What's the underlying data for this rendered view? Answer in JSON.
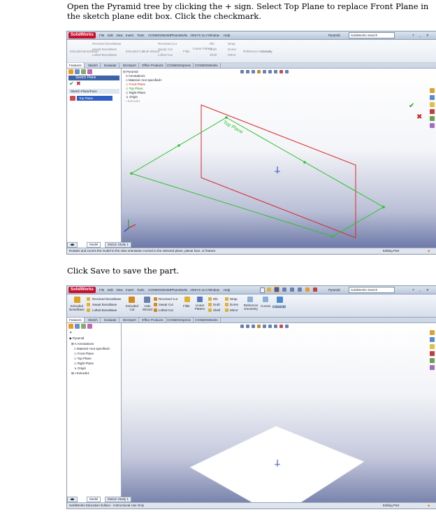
{
  "step1": {
    "instruction": "Open the Pyramid tree by clicking the + sign. Select Top Plane to replace Front Plane in the sketch plane edit box. Click the checkmark.",
    "app": {
      "logo": "SolidWorks",
      "menus": [
        "File",
        "Edit",
        "View",
        "Insert",
        "Tools",
        "COSMOSWorks",
        "PhotoWorks",
        "ANSYS 11.0",
        "Window",
        "Help"
      ],
      "doc_title": "Pyramid",
      "search_placeholder": "SolidWorks Search"
    },
    "ribbon": [
      "Extruded Boss/Base",
      "Revolved Boss/Base",
      "Swept Boss/Base",
      "Lofted Boss/Base",
      "Extruded Cut",
      "Hole Wizard",
      "Revolved Cut",
      "Swept Cut",
      "Lofted Cut",
      "Fillet",
      "Linear Pattern",
      "Rib",
      "Draft",
      "Shell",
      "Wrap",
      "Dome",
      "Mirror",
      "Reference Geometry",
      "Curves"
    ],
    "tabs": [
      "Features",
      "Sketch",
      "Evaluate",
      "DimXpert",
      "Office Products",
      "COSMOSXpress",
      "COSMOSWorks"
    ],
    "panel": {
      "title": "Sketch Plane",
      "section": "Sketch Plane/Face",
      "selection": "Top Plane"
    },
    "tree": [
      "Pyramid",
      "Annotations",
      "Material <not specified>",
      "Front Plane",
      "Top Plane",
      "Right Plane",
      "Origin",
      "Extrude1"
    ],
    "plane_label": "Top Plane",
    "bottom_tabs": [
      "Model",
      "Motion Study 1"
    ],
    "status": "Rotates and zooms the model to the view orientation normal to the selected plane, planar face, or feature.",
    "status_right": "Editing Part"
  },
  "step2": {
    "instruction": "Click Save to save the part.",
    "app": {
      "logo": "SolidWorks",
      "menus": [
        "File",
        "Edit",
        "View",
        "Insert",
        "Tools",
        "COSMOSWorks",
        "PhotoWorks",
        "ANSYS 11.0",
        "Window",
        "Help"
      ],
      "doc_title": "Pyramid",
      "search_placeholder": "SolidWorks Search"
    },
    "ribbon": [
      "Revolved Boss/Base",
      "Swept Boss/Base",
      "Lofted Boss/Base",
      "Extruded Boss/Base",
      "Extruded Cut",
      "Hole Wizard",
      "Revolved Cut",
      "Swept Cut",
      "Lofted Cut",
      "Fillet",
      "Linear Pattern",
      "Rib",
      "Draft",
      "Shell",
      "Wrap",
      "Dome",
      "Mirror",
      "Reference Geometry",
      "Curves",
      "Instant3D"
    ],
    "tabs": [
      "Features",
      "Sketch",
      "Evaluate",
      "DimXpert",
      "Office Products",
      "COSMOSXpress",
      "COSMOSWorks"
    ],
    "tree": [
      "Pyramid",
      "Annotations",
      "Material <not specified>",
      "Front Plane",
      "Top Plane",
      "Right Plane",
      "Origin",
      "Extrude1"
    ],
    "bottom_tabs": [
      "Model",
      "Motion Study 1"
    ],
    "status": "SolidWorks Education Edition - Instructional Use Only",
    "status_right": "Editing Part"
  }
}
